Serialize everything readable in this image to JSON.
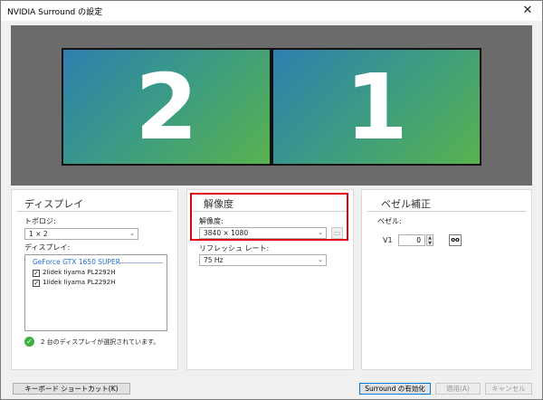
{
  "window": {
    "title": "NVIDIA Surround の設定",
    "close_glyph": "✕"
  },
  "preview": {
    "left_monitor": "2",
    "right_monitor": "1"
  },
  "display_panel": {
    "title": "ディスプレイ",
    "topology_label": "トポロジ:",
    "topology_value": "1 × 2",
    "displays_label": "ディスプレイ:",
    "gpu_name": "GeForce GTX 1650 SUPER",
    "monitors": [
      {
        "label": "2Iidek Iiyama PL2292H",
        "checked": true
      },
      {
        "label": "1Iidek Iiyama PL2292H",
        "checked": true
      }
    ],
    "status_text": "2 台のディスプレイが選択されています。"
  },
  "resolution_panel": {
    "title": "解像度",
    "resolution_label": "解像度:",
    "resolution_value": "3840 × 1080",
    "refresh_label": "リフレッシュ レート:",
    "refresh_value": "75  Hz"
  },
  "bezel_panel": {
    "title": "ベゼル補正",
    "bezel_label": "ベゼル:",
    "v1_label": "V1",
    "v1_value": "0"
  },
  "buttons": {
    "shortcut": "キーボード ショートカット(K)",
    "enable_surround": "Surround の有効化",
    "apply": "適用(A)",
    "cancel": "キャンセル"
  },
  "colors": {
    "highlight": "#e0000d",
    "accent": "#0078d7",
    "status_ok": "#3cb043"
  }
}
